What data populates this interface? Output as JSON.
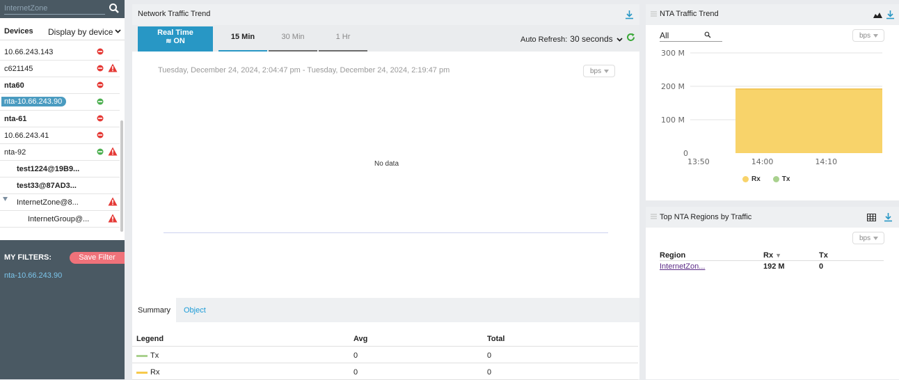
{
  "sidebar": {
    "search_value": "InternetZone",
    "devices_label": "Devices",
    "display_by": "Display by device",
    "devices": [
      {
        "name": "10.66.243.143",
        "bold": false,
        "status": "down",
        "warning": false,
        "selected": false
      },
      {
        "name": "c621145",
        "bold": false,
        "status": "down",
        "warning": true,
        "selected": false
      },
      {
        "name": "nta60",
        "bold": true,
        "status": "down",
        "warning": false,
        "selected": false
      },
      {
        "name": "nta-10.66.243.90",
        "bold": false,
        "status": "up",
        "warning": false,
        "selected": true
      },
      {
        "name": "nta-61",
        "bold": true,
        "status": "down",
        "warning": false,
        "selected": false
      },
      {
        "name": "10.66.243.41",
        "bold": false,
        "status": "down",
        "warning": false,
        "selected": false
      },
      {
        "name": "nta-92",
        "bold": false,
        "status": "up",
        "warning": true,
        "selected": false
      },
      {
        "name": "test1224@19B9...",
        "bold": true,
        "indent": 1
      },
      {
        "name": "test33@87AD3...",
        "bold": true,
        "indent": 1
      },
      {
        "name": "InternetZone@8...",
        "bold": false,
        "indent": 1,
        "warning": true,
        "expanded": true
      },
      {
        "name": "InternetGroup@...",
        "bold": false,
        "indent": 2,
        "warning": true
      }
    ],
    "filters_label": "MY FILTERS:",
    "save_filter_label": "Save Filter",
    "filter_items": [
      "nta-10.66.243.90"
    ]
  },
  "traffic_trend": {
    "title": "Network Traffic Trend",
    "realtime_label": "Real Time",
    "realtime_state": "ON",
    "tabs": [
      "15 Min",
      "30 Min",
      "1 Hr"
    ],
    "active_tab": "15 Min",
    "auto_refresh_label": "Auto Refresh:",
    "auto_refresh_value": "30 seconds",
    "date_range": "Tuesday, December 24, 2024, 2:04:47 pm - Tuesday, December 24, 2024, 2:19:47 pm",
    "unit": "bps",
    "no_data": "No data"
  },
  "summary": {
    "tabs": [
      "Summary",
      "Object"
    ],
    "headers": [
      "Legend",
      "Avg",
      "Total"
    ],
    "rows": [
      {
        "legend": "Tx",
        "color": "#a9d18e",
        "avg": "0",
        "total": "0"
      },
      {
        "legend": "Rx",
        "color": "#f7c94b",
        "avg": "0",
        "total": "0"
      }
    ]
  },
  "nta_trend": {
    "title": "NTA Traffic Trend",
    "search_value": "All",
    "unit": "bps",
    "chart_data": {
      "type": "area",
      "x": [
        "13:56",
        "14:19"
      ],
      "x_ticks": [
        "13:50",
        "14:00",
        "14:10"
      ],
      "y_ticks": [
        "0",
        "100 M",
        "200 M",
        "300 M"
      ],
      "ylim": [
        0,
        300
      ],
      "series": [
        {
          "name": "Rx",
          "color": "#f8d36a",
          "values": [
            192,
            192
          ]
        },
        {
          "name": "Tx",
          "color": "#a9d18e",
          "values": [
            0,
            0
          ]
        }
      ]
    }
  },
  "regions": {
    "title": "Top NTA Regions by Traffic",
    "unit": "bps",
    "headers": [
      "Region",
      "Rx",
      "Tx"
    ],
    "rows": [
      {
        "region": "InternetZon...",
        "rx": "192 M",
        "tx": "0"
      }
    ]
  }
}
